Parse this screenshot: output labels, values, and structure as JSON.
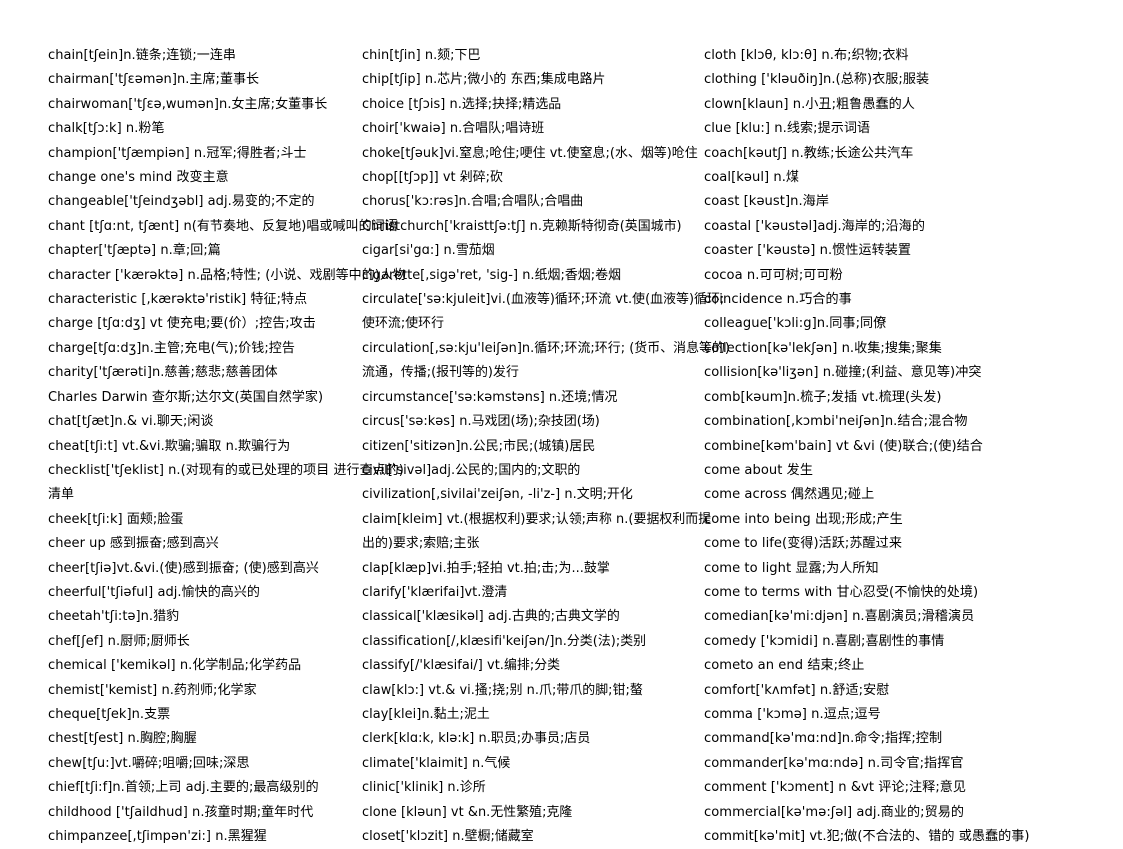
{
  "document": {
    "type": "vocabulary-list",
    "page_background": "#ffffff",
    "text_color": "#000000",
    "columns_count": 3
  },
  "columns": [
    {
      "name": "column-1",
      "entries": [
        "chain[tʃein]n.链条;连锁;一连串",
        "chairman['tʃɛəmən]n.主席;董事长",
        "chairwoman['tʃɛə,wumən]n.女主席;女董事长",
        "chalk[tʃɔ:k] n.粉笔",
        "champion['tʃæmpiən] n.冠军;得胜者;斗士",
        "change one's mind  改变主意",
        "changeable['tʃeindʒəbl] adj.易变的;不定的",
        "chant [tʃɑ:nt, tʃænt] n(有节奏地、反复地)唱或喊叫的词语",
        "chapter['tʃæptə] n.章;回;篇",
        "character ['kærəktə] n.品格;特性; (小说、戏剧等中的)人物",
        "characteristic [,kærəktə'ristik]  特征;特点",
        "charge [tʃɑ:dʒ] vt  使充电;要(价）;控告;攻击",
        "charge[tʃɑ:dʒ]n.主管;充电(气);价钱;控告",
        "charity['tʃærəti]n.慈善;慈悲;慈善团体",
        "Charles Darwin  查尔斯;达尔文(英国自然学家)",
        "chat[tʃæt]n.& vi.聊天;闲谈",
        "cheat[tʃi:t] vt.&vi.欺骗;骗取  n.欺骗行为",
        "checklist['tʃeklist]  n.(对现有的或已处理的项目  进行查点的)",
        "清单",
        "cheek[tʃi:k]  面颊;脸蛋",
        "cheer up  感到振奋;感到高兴",
        "cheer[tʃiə]vt.&vi.(使)感到振奋; (使)感到高兴",
        "cheerful['tʃiəful]  adj.愉快的高兴的",
        "cheetah'tʃi:tə]n.猎豹",
        "chef[ʃef] n.厨师;厨师长",
        "chemical ['kemikəl] n.化学制品;化学药品",
        "chemist['kemist] n.药剂师;化学家",
        "cheque[tʃek]n.支票",
        "chest[tʃest] n.胸腔;胸腛",
        "chew[tʃu:]vt.嚼碎;咀嚼;回味;深思",
        "chief[tʃi:f]n.首领;上司  adj.主要的;最高级别的",
        "childhood ['tʃaildhud] n.孩童时期;童年时代",
        "chimpanzee[,tʃimpən'zi:] n.黑猩猩"
      ]
    },
    {
      "name": "column-2",
      "entries": [
        "chin[tʃin] n.颏;下巴",
        "chip[tʃip] n.芯片;微小的  东西;集成电路片",
        "choice [tʃɔis] n.选择;抉择;精选品",
        "choir['kwaiə] n.合唱队;唱诗班",
        "choke[tʃəuk]vi.窒息;呛住;哽住  vt.使窒息;(水、烟等)呛住",
        "chop[[tʃɔp]] vt  剁碎;砍",
        "chorus['kɔ:rəs]n.合唱;合唱队;合唱曲",
        "Christchurch['kraisttʃə:tʃ] n.克赖斯特彻奇(英国城市)",
        "cigar[si'gɑ:] n.雪茄烟",
        "cigarette[,sigə'ret, 'sig-] n.纸烟;香烟;卷烟",
        "circulate['sə:kjuleit]vi.(血液等)循环;环流  vt.使(血液等)循环;",
        "使环流;使环行",
        "circulation[,sə:kju'leiʃən]n.循环;环流;环行; (货币、消息等的)",
        "流通，传播;(报刊等的)发行",
        "circumstance['sə:kəmstəns] n.还境;情况",
        "circus['sə:kəs] n.马戏团(场);杂技团(场)",
        "citizen['sitizən]n.公民;市民;(城镇)居民",
        "civil['sivəl]adj.公民的;国内的;文职的",
        "civilization[,sivilai'zeiʃən, -li'z-] n.文明;开化",
        "claim[kleim]  vt.(根据权利)要求;认领;声称  n.(要据权利而提",
        "出的)要求;索赔;主张",
        "clap[klæp]vi.拍手;轻拍  vt.拍;击;为...鼓掌",
        "clarify['klærifai]vt.澄清",
        "classical['klæsikəl] adj.古典的;古典文学的",
        "classification[/,klæsifi'keiʃən/]n.分类(法);类别",
        "classify[/'klæsifai/] vt.编排;分类",
        "claw[klɔ:] vt.& vi.搔;挠;别  n.爪;带爪的脚;钳;螯",
        "clay[klei]n.黏土;泥土",
        "clerk[klɑ:k, klə:k] n.职员;办事员;店员",
        "climate['klaimit] n.气候",
        "clinic['klinik]  n.诊所",
        "clone [kləun] vt &n.无性繁殖;克隆",
        "closet['klɔzit] n.壁橱;储藏室"
      ]
    },
    {
      "name": "column-3",
      "entries": [
        "cloth [klɔθ, klɔ:θ] n.布;织物;衣料",
        "clothing ['kləuðiŋ]n.(总称)衣服;服装",
        "clown[klaun] n.小丑;粗鲁愚蠢的人",
        "clue [klu:] n.线索;提示词语",
        "coach[kəutʃ] n.教练;长途公共汽车",
        "coal[kəul] n.煤",
        "coast [kəust]n.海岸",
        "coastal ['kəustəl]adj.海岸的;沿海的",
        "coaster ['kəustə] n.惯性运转装置",
        "cocoa n.可可树;可可粉",
        "coincidence n.巧合的事",
        "colleague['kɔli:g]n.同事;同僚",
        "collection[kə'lekʃən] n.收集;搜集;聚集",
        "collision[kə'liʒən] n.碰撞;(利益、意见等)冲突",
        "comb[kəum]n.梳子;发插  vt.梳理(头发)",
        "combination[,kɔmbi'neiʃən]n.结合;混合物",
        "combine[kəm'bain] vt &vi (使)联合;(使)结合",
        "come about  发生",
        "come across  偶然遇见;碰上",
        "come into being  出现;形成;产生",
        "come to life(变得)活跃;苏醒过来",
        "come to light  显露;为人所知",
        "come to terms with  甘心忍受(不愉快的处境)",
        "comedian[kə'mi:djən] n.喜剧演员;滑稽演员",
        "comedy ['kɔmidi] n.喜剧;喜剧性的事情",
        "cometo an end  结束;终止",
        "comfort['kʌmfət] n.舒适;安慰",
        "comma ['kɔmə] n.逗点;逗号",
        "command[kə'mɑ:nd]n.命令;指挥;控制",
        "commander[kə'mɑ:ndə] n.司令官;指挥官",
        "comment ['kɔment] n &vt  评论;注释;意见",
        "commercial[kə'mə:ʃəl] adj.商业的;贸易的",
        "commit[kə'mit] vt.犯;做(不合法的、错的  或愚蠢的事)"
      ]
    }
  ]
}
